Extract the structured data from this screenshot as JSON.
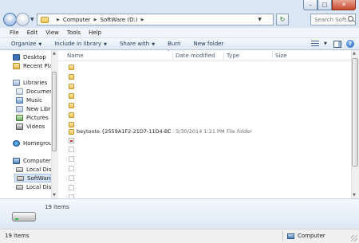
{
  "address": {
    "crumbs": [
      "Computer",
      "SoftWare (D:)"
    ]
  },
  "search": {
    "placeholder": "Search Soft..."
  },
  "menubar": [
    "File",
    "Edit",
    "View",
    "Tools",
    "Help"
  ],
  "commandbar": {
    "organize": "Organize",
    "include": "Include in library",
    "share": "Share with",
    "burn": "Burn",
    "newfolder": "New folder"
  },
  "nav": [
    {
      "label": "Desktop",
      "icon": "desktop-icon"
    },
    {
      "label": "Recent Plac",
      "icon": "recent-places-icon"
    },
    {
      "label": "Libraries",
      "icon": "libraries-icon"
    },
    {
      "label": "Documents",
      "icon": "documents-icon"
    },
    {
      "label": "Music",
      "icon": "music-icon"
    },
    {
      "label": "New Library",
      "icon": "library-icon"
    },
    {
      "label": "Pictures",
      "icon": "pictures-icon"
    },
    {
      "label": "Videos",
      "icon": "videos-icon"
    },
    {
      "label": "Homegroup",
      "icon": "homegroup-icon"
    },
    {
      "label": "Computer",
      "icon": "computer-icon"
    },
    {
      "label": "Local Disk (",
      "icon": "disk-icon"
    },
    {
      "label": "SoftWare (D",
      "icon": "disk-icon",
      "selected": true
    },
    {
      "label": "Local Disk (",
      "icon": "disk-icon"
    }
  ],
  "columns": {
    "name": "Name",
    "date": "Date modified",
    "type": "Type",
    "size": "Size"
  },
  "files": [
    {
      "icon": "folder-icon",
      "name": "",
      "date": "",
      "type": ""
    },
    {
      "icon": "folder-icon",
      "name": "",
      "date": "",
      "type": ""
    },
    {
      "icon": "folder-icon",
      "name": "",
      "date": "",
      "type": ""
    },
    {
      "icon": "folder-icon",
      "name": "",
      "date": "",
      "type": ""
    },
    {
      "icon": "folder-icon",
      "name": "",
      "date": "",
      "type": ""
    },
    {
      "icon": "folder-icon",
      "name": "",
      "date": "",
      "type": ""
    },
    {
      "icon": "folder-icon",
      "name": "",
      "date": "",
      "type": ""
    },
    {
      "icon": "folder-icon",
      "name": "beytoote.{2559A1F2-21D7-11D4-BDAF-00...",
      "date": "3/30/2014 1:21 PM",
      "type": "File folder"
    },
    {
      "icon": "red-file-icon",
      "name": "",
      "date": "",
      "type": ""
    },
    {
      "icon": "file-icon",
      "name": "",
      "date": "",
      "type": ""
    },
    {
      "icon": "file-icon",
      "name": "",
      "date": "",
      "type": ""
    },
    {
      "icon": "file-icon",
      "name": "",
      "date": "",
      "type": ""
    },
    {
      "icon": "file-icon",
      "name": "",
      "date": "",
      "type": ""
    },
    {
      "icon": "file-icon",
      "name": "",
      "date": "",
      "type": ""
    },
    {
      "icon": "file-icon",
      "name": "",
      "date": "",
      "type": ""
    }
  ],
  "details": {
    "text": "19 items"
  },
  "status": {
    "left": "19 items",
    "right": "Computer"
  }
}
